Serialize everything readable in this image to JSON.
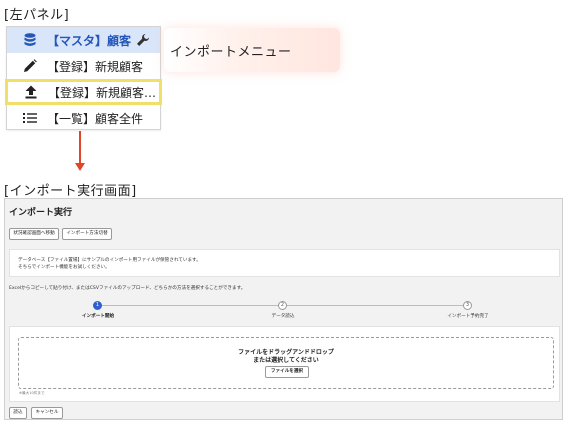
{
  "left_panel_label": "[左パネル]",
  "menu": {
    "items": [
      {
        "icon": "database-icon",
        "label": "【マスタ】顧客"
      },
      {
        "icon": "pencil-icon",
        "label": "【登録】新規顧客"
      },
      {
        "icon": "upload-icon",
        "label": "【登録】新規顧客…"
      },
      {
        "icon": "list-icon",
        "label": "【一覧】顧客全件"
      }
    ],
    "settings_icon": "wrench-icon"
  },
  "callout": "インポートメニュー",
  "import_screen_label": "[インポート実行画面]",
  "screen": {
    "title": "インポート実行",
    "buttons": {
      "status": "状況確認画面へ移動",
      "method": "インポート方法切替"
    },
    "info": [
      "データベース【ファイル置場】にサンプルのインポート用ファイルが保管されています。",
      "そちらでインポート機能をお試しください。"
    ],
    "description": "Excelからコピーして貼り付け、またはCSVファイルのアップロード、どちらかの方法を選択することができます。",
    "steps": [
      {
        "number": "1",
        "label": "インポート開始"
      },
      {
        "number": "2",
        "label": "データ読込"
      },
      {
        "number": "3",
        "label": "インポート予約完了"
      }
    ],
    "dropzone": {
      "line1": "ファイルをドラッグアンドドロップ",
      "line2": "または選択してください",
      "select_button": "ファイルを選択"
    },
    "note": "※最大10件まで",
    "footer": {
      "load_button": "読込",
      "cancel_button": "キャンセル"
    }
  },
  "colors": {
    "accent": "#2f5fd0",
    "highlight_border": "#f0e06a",
    "arrow": "#e0452a",
    "selected_menu_bg": "#d9e6fa"
  }
}
